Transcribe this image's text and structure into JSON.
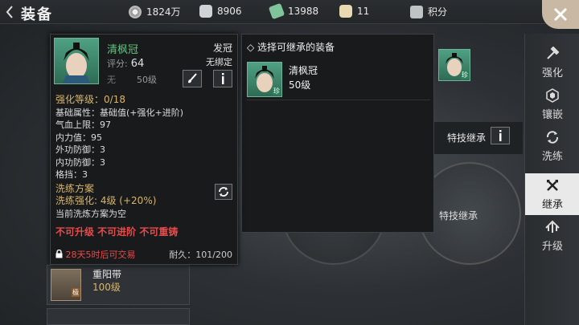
{
  "header": {
    "title": "装备"
  },
  "resources": [
    {
      "icon": "film-reel-icon",
      "value": "1824万"
    },
    {
      "icon": "silver-ingot-icon",
      "value": "8906"
    },
    {
      "icon": "ticket-icon",
      "value": "13988"
    },
    {
      "icon": "gold-ingot-icon",
      "value": "11"
    },
    {
      "icon": "points-badge-icon",
      "value": "积分"
    }
  ],
  "sidenav": {
    "items": [
      {
        "label": "强化",
        "icon": "hammer-icon"
      },
      {
        "label": "镶嵌",
        "icon": "gem-icon"
      },
      {
        "label": "洗练",
        "icon": "refine-icon"
      },
      {
        "label": "继承",
        "icon": "inherit-icon",
        "active": true
      },
      {
        "label": "升级",
        "icon": "upgrade-icon"
      }
    ]
  },
  "tooltip": {
    "name": "清枫冠",
    "score_label": "评分:",
    "score": "64",
    "none": "无",
    "level": "50级",
    "slot": "发冠",
    "bind": "无绑定",
    "enhance": "强化等级：0/18",
    "base_attr": "基础属性：基础值(+强化+进阶)",
    "attrs": [
      "气血上限：97",
      "内力值：95",
      "外功防御：3",
      "内功防御：3",
      "格挡：3"
    ],
    "refine_title": "洗练方案",
    "refine_enhance": "洗练强化: 4级 (+20%)",
    "refine_current": "当前洗炼方案为空",
    "restrict": "不可升级  不可进阶  不可重铸",
    "trade": "28天5时后可交易",
    "durability": "耐久：101/200"
  },
  "select_panel": {
    "header": "选择可继承的装备",
    "item": {
      "name": "清枫冠",
      "level": "50级",
      "tag": "珍"
    }
  },
  "right": {
    "portrait_tag": "珍",
    "skill_inherit": "特技继承",
    "skill_inherit_circle": "特技继承"
  },
  "list": {
    "item": {
      "name": "重阳带",
      "level": "100级",
      "tag": "极"
    }
  }
}
